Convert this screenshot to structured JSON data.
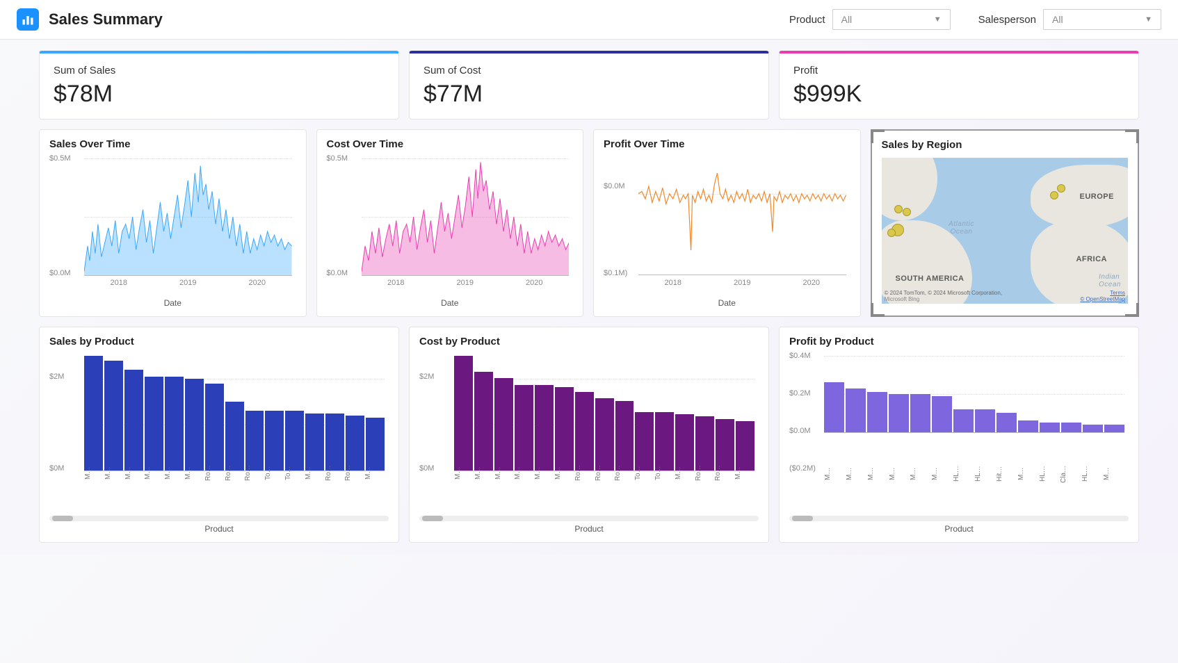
{
  "header": {
    "title": "Sales Summary",
    "filters": {
      "product": {
        "label": "Product",
        "value": "All"
      },
      "salesperson": {
        "label": "Salesperson",
        "value": "All"
      }
    }
  },
  "kpis": [
    {
      "label": "Sum of Sales",
      "value": "$78M",
      "accent": "#39a8ff"
    },
    {
      "label": "Sum of Cost",
      "value": "$77M",
      "accent": "#2e2f9b"
    },
    {
      "label": "Profit",
      "value": "$999K",
      "accent": "#e93cb0"
    }
  ],
  "charts": {
    "sales_time": {
      "title": "Sales Over Time",
      "xlabel": "Date",
      "y_ticks": [
        "$0.5M",
        "$0.0M"
      ],
      "x_ticks": [
        "2018",
        "2019",
        "2020"
      ],
      "color": "#39a8ff"
    },
    "cost_time": {
      "title": "Cost Over Time",
      "xlabel": "Date",
      "y_ticks": [
        "$0.5M",
        "$0.0M"
      ],
      "x_ticks": [
        "2018",
        "2019",
        "2020"
      ],
      "color": "#e83fb1"
    },
    "profit_time": {
      "title": "Profit Over Time",
      "xlabel": "Date",
      "y_ticks": [
        "$0.0M",
        "$0.1M)"
      ],
      "x_ticks": [
        "2018",
        "2019",
        "2020"
      ],
      "color": "#f0892b"
    },
    "sales_region": {
      "title": "Sales by Region",
      "labels": {
        "europe": "EUROPE",
        "africa": "AFRICA",
        "south_america": "SOUTH AMERICA",
        "atlantic": "Atlantic Ocean",
        "india": "Indian Ocean"
      },
      "credits": {
        "left": "© 2024 TomTom, © 2024 Microsoft Corporation,",
        "bing": "Microsoft Bing",
        "terms": "Terms",
        "osm": "© OpenStreetMap"
      }
    },
    "sales_product": {
      "title": "Sales by Product",
      "xlabel": "Product",
      "y_ticks": [
        "$2M",
        "$0M"
      ],
      "color": "#2b3fb8",
      "x_ticks": [
        "M…",
        "M…",
        "M…",
        "M…",
        "M…",
        "M…",
        "Ro…",
        "Ro…",
        "Ro…",
        "To…",
        "To…",
        "M…",
        "Ro…",
        "Ro…",
        "M…"
      ]
    },
    "cost_product": {
      "title": "Cost by Product",
      "xlabel": "Product",
      "y_ticks": [
        "$2M",
        "$0M"
      ],
      "color": "#6b1980",
      "x_ticks": [
        "M…",
        "M…",
        "M…",
        "M…",
        "M…",
        "M…",
        "Ro…",
        "Ro…",
        "Ro…",
        "To…",
        "To…",
        "M…",
        "Ro…",
        "Ro…",
        "M…"
      ]
    },
    "profit_product": {
      "title": "Profit by Product",
      "xlabel": "Product",
      "y_ticks": [
        "$0.4M",
        "$0.2M",
        "$0.0M",
        "($0.2M)"
      ],
      "color": "#7e67de",
      "x_ticks": [
        "M…",
        "M…",
        "M…",
        "M…",
        "M…",
        "M…",
        "HL…",
        "HL…",
        "Hit…",
        "M…",
        "HL…",
        "Cla…",
        "HL…",
        "M…"
      ]
    }
  },
  "chart_data": [
    {
      "type": "line",
      "title": "Sales Over Time",
      "xlabel": "Date",
      "ylabel": "",
      "ylim": [
        0,
        500000
      ],
      "x_range": [
        "2017-07",
        "2020-07"
      ],
      "series": [
        {
          "name": "Sales",
          "note": "approx daily values ranging $0–$0.5M, peaking mid-2019"
        }
      ]
    },
    {
      "type": "line",
      "title": "Cost Over Time",
      "xlabel": "Date",
      "ylabel": "",
      "ylim": [
        0,
        500000
      ],
      "x_range": [
        "2017-07",
        "2020-07"
      ],
      "series": [
        {
          "name": "Cost",
          "note": "approx daily values ranging $0–$0.55M, peaking mid-2019"
        }
      ]
    },
    {
      "type": "line",
      "title": "Profit Over Time",
      "xlabel": "Date",
      "ylabel": "",
      "ylim": [
        -100000,
        50000
      ],
      "x_range": [
        "2017-07",
        "2020-07"
      ],
      "series": [
        {
          "name": "Profit",
          "note": "oscillates around 0; dips to approx -$0.1M in 2018 and late 2019"
        }
      ]
    },
    {
      "type": "bar",
      "title": "Sales by Product",
      "xlabel": "Product",
      "ylabel": "",
      "ylim": [
        0,
        2500000
      ],
      "categories": [
        "M…",
        "M…",
        "M…",
        "M…",
        "M…",
        "M…",
        "Ro…",
        "Ro…",
        "Ro…",
        "To…",
        "To…",
        "M…",
        "Ro…",
        "Ro…",
        "M…"
      ],
      "values": [
        2500000,
        2400000,
        2200000,
        2050000,
        2050000,
        2000000,
        1900000,
        1500000,
        1300000,
        1300000,
        1300000,
        1250000,
        1250000,
        1200000,
        1150000
      ]
    },
    {
      "type": "bar",
      "title": "Cost by Product",
      "xlabel": "Product",
      "ylabel": "",
      "ylim": [
        0,
        2500000
      ],
      "categories": [
        "M…",
        "M…",
        "M…",
        "M…",
        "M…",
        "M…",
        "Ro…",
        "Ro…",
        "Ro…",
        "To…",
        "To…",
        "M…",
        "Ro…",
        "Ro…",
        "M…"
      ],
      "values": [
        2550000,
        2200000,
        2050000,
        1900000,
        1900000,
        1850000,
        1750000,
        1600000,
        1550000,
        1300000,
        1300000,
        1250000,
        1200000,
        1150000,
        1100000
      ]
    },
    {
      "type": "bar",
      "title": "Profit by Product",
      "xlabel": "Product",
      "ylabel": "",
      "ylim": [
        -200000,
        400000
      ],
      "categories": [
        "M…",
        "M…",
        "M…",
        "M…",
        "M…",
        "M…",
        "HL…",
        "HL…",
        "Hit…",
        "M…",
        "HL…",
        "Cla…",
        "HL…",
        "M…"
      ],
      "values": [
        260000,
        230000,
        210000,
        200000,
        200000,
        190000,
        120000,
        120000,
        100000,
        60000,
        50000,
        50000,
        40000,
        40000
      ]
    },
    {
      "type": "map",
      "title": "Sales by Region",
      "points_approx": [
        "Europe (cluster, ~2 dots)",
        "West Africa/Atlantic (cluster, ~4 dots)"
      ]
    }
  ]
}
